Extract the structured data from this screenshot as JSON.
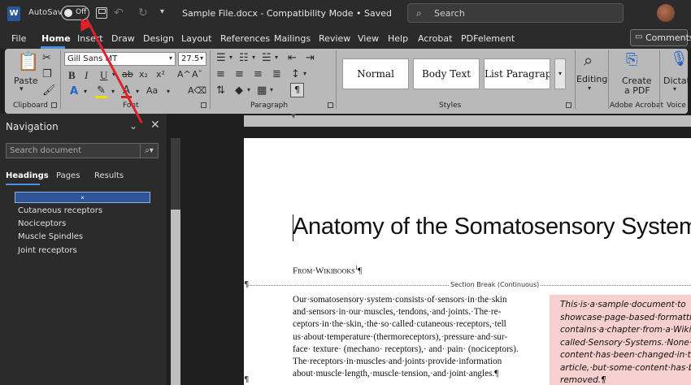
{
  "titlebar": {
    "app_icon": "W",
    "autosave_label": "AutoSave",
    "autosave_state": "Off",
    "file_title": "Sample File.docx  -  Compatibility Mode • Saved",
    "search_placeholder": "Search"
  },
  "tabs": [
    "File",
    "Home",
    "Insert",
    "Draw",
    "Design",
    "Layout",
    "References",
    "Mailings",
    "Review",
    "View",
    "Help",
    "Acrobat",
    "PDFelement"
  ],
  "comments_label": "Comments",
  "ribbon": {
    "clipboard": {
      "paste": "Paste",
      "label": "Clipboard"
    },
    "font": {
      "family": "Gill Sans MT",
      "size": "27.5",
      "label": "Font"
    },
    "paragraph": {
      "label": "Paragraph",
      "pilcrow": "¶"
    },
    "styles": {
      "items": [
        "Normal",
        "Body Text",
        "List Paragraph"
      ],
      "label": "Styles"
    },
    "editing": {
      "label": "Editing"
    },
    "adobe": {
      "create": "Create",
      "pdf": "a PDF",
      "label": "Adobe Acrobat"
    },
    "voice": {
      "dictate": "Dictate",
      "label": "Voice"
    }
  },
  "navigation": {
    "title": "Navigation",
    "search_placeholder": "Search document",
    "tabs": [
      "Headings",
      "Pages",
      "Results"
    ],
    "headings": [
      "Cutaneous receptors",
      "Nociceptors",
      "Muscle Spindles",
      "Joint receptors"
    ]
  },
  "document": {
    "title": "Anatomy of the Somatosensory System¶",
    "from_line": "From·Wikibooks",
    "from_sup": "1",
    "section_break": "Section Break (Continuous)",
    "body_lines": [
      "Our·somatosensory·system·consists·of·sensors·in·the·skin",
      "and·sensors·in·our·muscles,·tendons,·and·joints.·The·re-",
      "ceptors·in·the·skin,·the·so·called·cutaneous·receptors,·tell",
      "us·about·temperature·(thermoreceptors),·pressure·and·sur-",
      "face· texture· (mechano· receptors),· and· pain· (nociceptors).",
      "The·receptors·in·muscles·and·joints·provide·information",
      "about·muscle·length,·muscle·tension,·and·joint·angles.¶"
    ],
    "sidebar_lines": [
      "This·is·a·sample·document·to",
      "showcase·page-based·formattin",
      "contains·a·chapter·from·a·Wikib",
      "called·Sensory·Systems.·None·o",
      "content·has·been·changed·in·th",
      "article,·but·some·content·has·b",
      "removed.¶"
    ]
  },
  "colors": {
    "accent": "#4a90e2",
    "annotation": "#e0202a",
    "sidebar_fill": "#f6cfcf"
  }
}
